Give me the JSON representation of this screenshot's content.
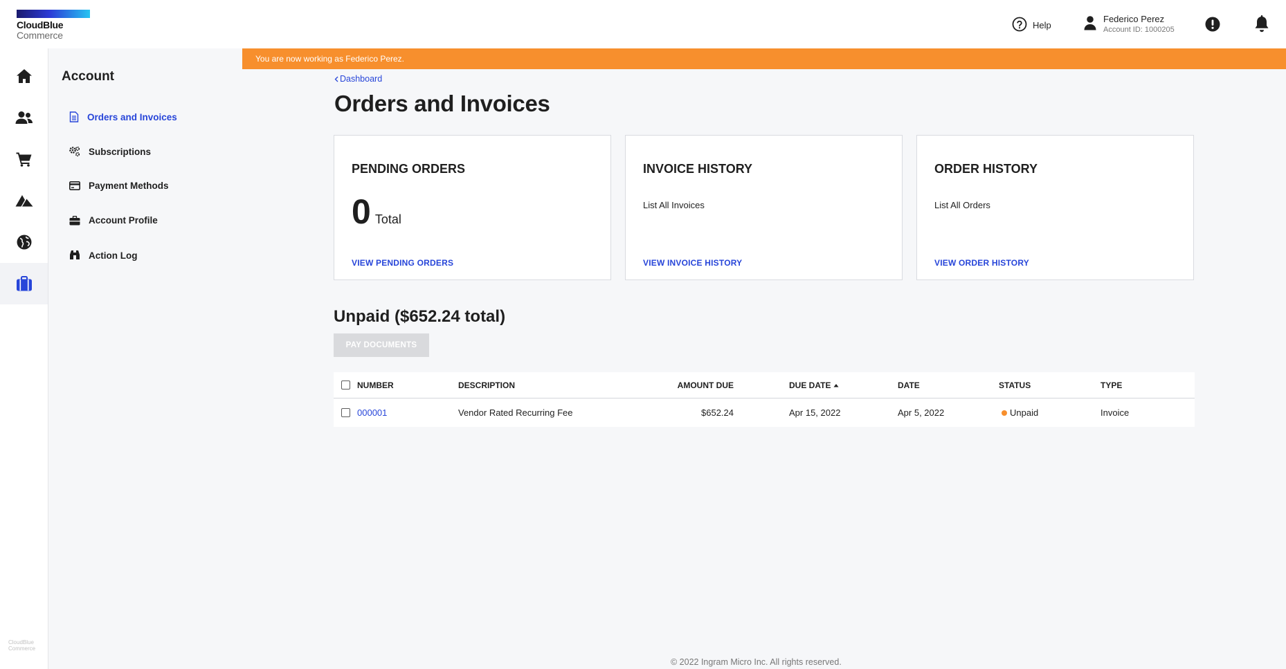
{
  "brand": {
    "line1": "CloudBlue",
    "line2": "Commerce",
    "rail_footer_line1": "CloudBlue",
    "rail_footer_line2": "Commerce"
  },
  "header": {
    "help_label": "Help",
    "user_name": "Federico Perez",
    "account_id": "Account ID: 1000205"
  },
  "rail": {
    "items": [
      {
        "icon": "home-icon"
      },
      {
        "icon": "users-icon"
      },
      {
        "icon": "cart-icon"
      },
      {
        "icon": "mountains-icon"
      },
      {
        "icon": "globe-icon"
      },
      {
        "icon": "briefcase-icon",
        "active": true
      }
    ]
  },
  "subnav": {
    "title": "Account",
    "items": [
      {
        "label": "Orders and Invoices",
        "icon": "document-icon",
        "active": true
      },
      {
        "label": "Subscriptions",
        "icon": "gears-icon"
      },
      {
        "label": "Payment Methods",
        "icon": "credit-card-icon"
      },
      {
        "label": "Account Profile",
        "icon": "briefcase-icon"
      },
      {
        "label": "Action Log",
        "icon": "binoculars-icon"
      }
    ]
  },
  "banner": {
    "text": "You are now working as Federico Perez."
  },
  "breadcrumb": {
    "label": "Dashboard"
  },
  "page": {
    "title": "Orders and Invoices"
  },
  "cards": {
    "pending": {
      "title": "PENDING ORDERS",
      "count": "0",
      "count_label": "Total",
      "link": "VIEW PENDING ORDERS"
    },
    "invoice": {
      "title": "INVOICE HISTORY",
      "subtitle": "List All Invoices",
      "link": "VIEW INVOICE HISTORY"
    },
    "order": {
      "title": "ORDER HISTORY",
      "subtitle": "List All Orders",
      "link": "VIEW ORDER HISTORY"
    }
  },
  "unpaid": {
    "title": "Unpaid ($652.24 total)",
    "pay_button": "PAY DOCUMENTS"
  },
  "table": {
    "headers": {
      "number": "NUMBER",
      "description": "DESCRIPTION",
      "amount_due": "AMOUNT DUE",
      "due_date": "DUE DATE",
      "date": "DATE",
      "status": "STATUS",
      "type": "TYPE"
    },
    "sort": {
      "column": "due_date",
      "direction": "ascending"
    },
    "rows": [
      {
        "number": "000001",
        "description": "Vendor Rated Recurring Fee",
        "amount_due": "$652.24",
        "due_date": "Apr 15, 2022",
        "date": "Apr 5, 2022",
        "status": "Unpaid",
        "type": "Invoice"
      }
    ]
  },
  "colors": {
    "accent": "#2745d9",
    "banner": "#f78f2d",
    "status_unpaid": "#f78f2d"
  },
  "footer": {
    "text": "© 2022 Ingram Micro Inc. All rights reserved."
  }
}
